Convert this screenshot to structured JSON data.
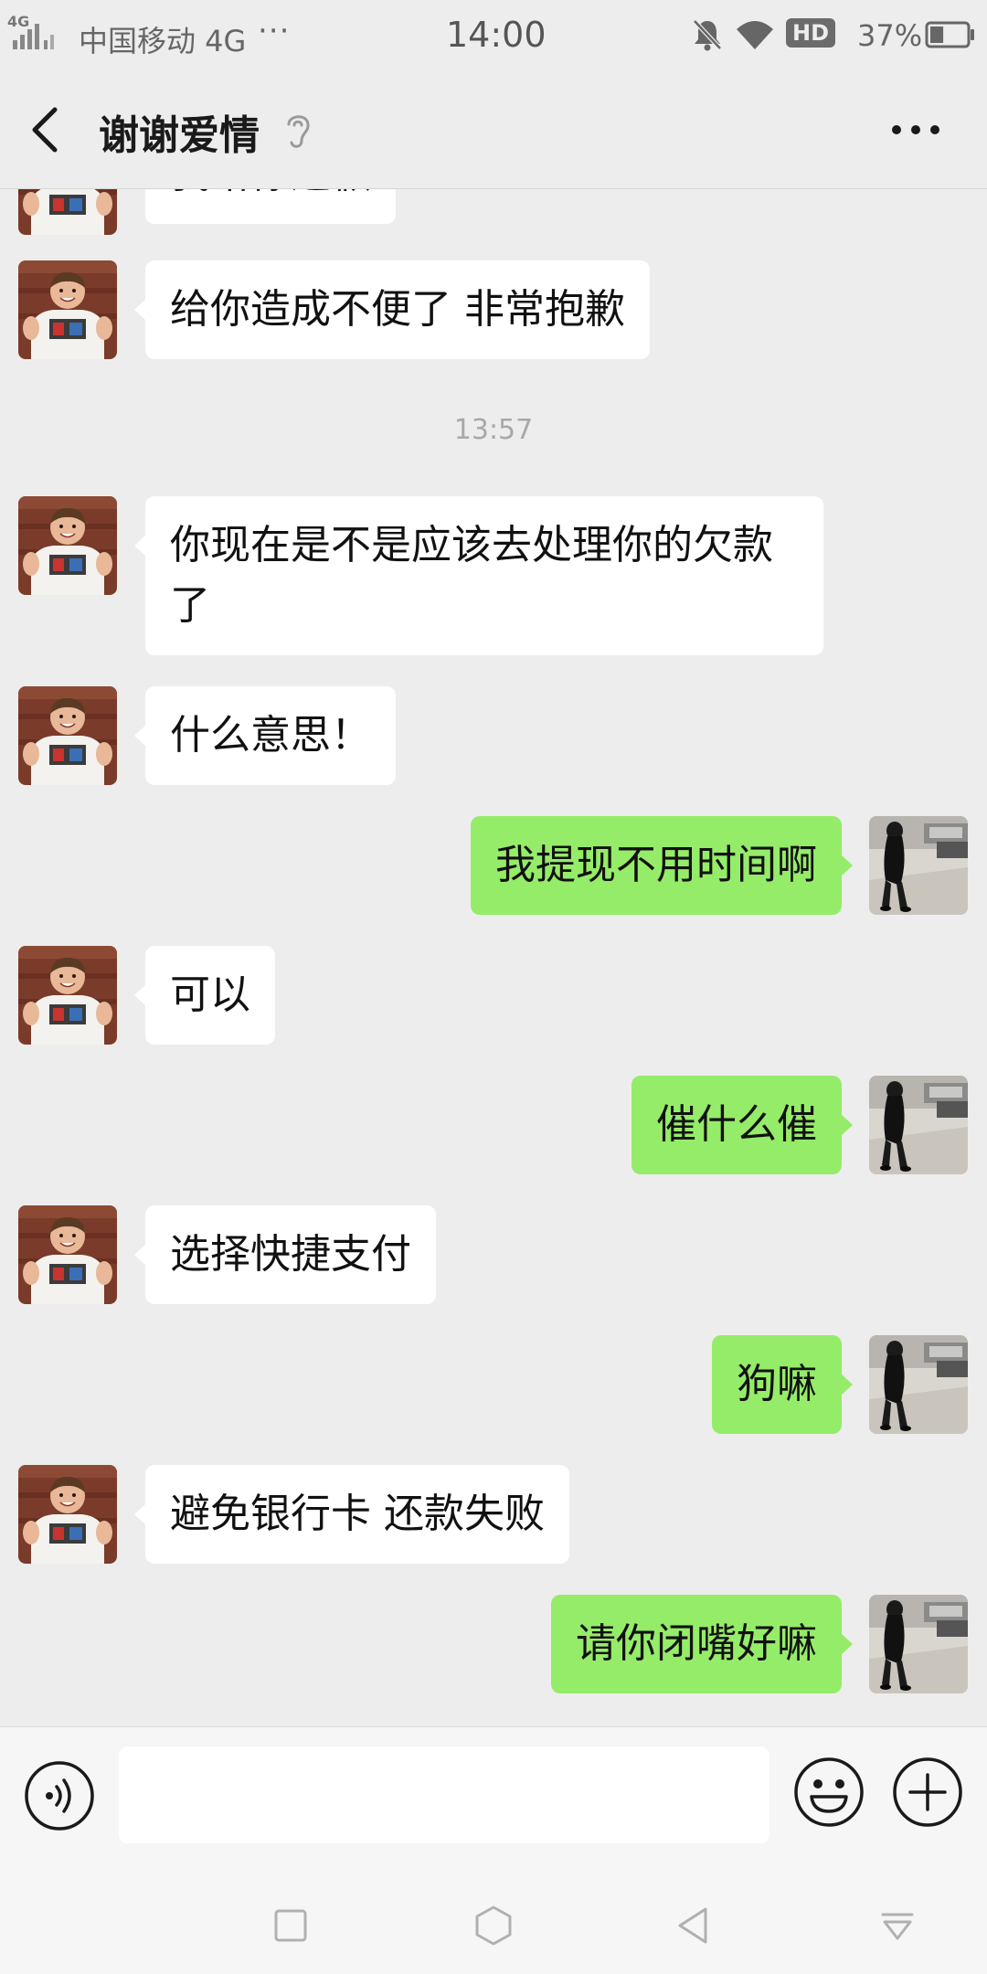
{
  "status_bar": {
    "signal_label": "4G",
    "carrier": "中国移动 4G",
    "dots": "···",
    "time": "14:00",
    "hd_label": "HD",
    "battery_percent": "37%",
    "battery_level": 0.37
  },
  "header": {
    "title": "谢谢爱情",
    "icons": [
      "back-icon",
      "ear-icon",
      "more-icon"
    ]
  },
  "chat": {
    "messages": [
      {
        "side": "left",
        "text": "我给你道歉"
      },
      {
        "side": "left",
        "text": "给你造成不便了  非常抱歉"
      },
      {
        "side": "left",
        "text": "你现在是不是应该去处理你的欠款了"
      },
      {
        "side": "left",
        "text": "什么意思！"
      },
      {
        "side": "right",
        "text": "我提现不用时间啊"
      },
      {
        "side": "left",
        "text": "可以"
      },
      {
        "side": "right",
        "text": "催什么催"
      },
      {
        "side": "left",
        "text": "选择快捷支付"
      },
      {
        "side": "right",
        "text": "狗嘛"
      },
      {
        "side": "left",
        "text": "避免银行卡 还款失败"
      },
      {
        "side": "right",
        "text": "请你闭嘴好嘛"
      }
    ],
    "timestamp": "13:57"
  },
  "input_bar": {
    "value": "",
    "placeholder": "",
    "icons": [
      "voice-icon",
      "emoji-icon",
      "plus-icon"
    ]
  },
  "nav_bar": {
    "icons": [
      "square-icon",
      "hexagon-icon",
      "triangle-back-icon",
      "pull-down-icon"
    ]
  },
  "colors": {
    "background": "#ededed",
    "bubble_self": "#95ec69",
    "bubble_other": "#ffffff"
  }
}
